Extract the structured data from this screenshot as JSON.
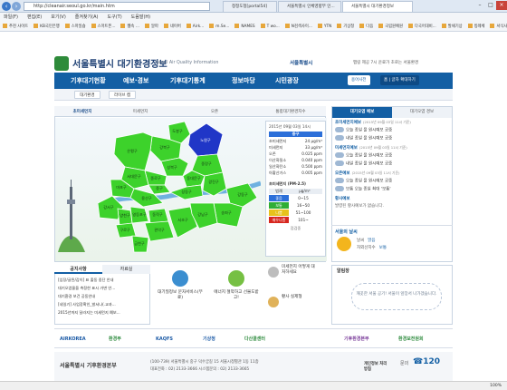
{
  "browser": {
    "url": "http://cleanair.seoul.go.kr/main.htm",
    "tabs": [
      "청정도청[portal54]",
      "서울특별시 인체영향부 인...",
      "서울특별시 대기환경정보"
    ],
    "menu": [
      "파일(F)",
      "편집(E)",
      "보기(V)",
      "즐겨찾기(A)",
      "도구(T)",
      "도움말(H)"
    ],
    "favorites": [
      "추천 사이트",
      "KB국민은행",
      "스마일숍",
      "스마트폰...",
      "웹속 …",
      "알파",
      "네이버",
      "Airk...",
      "m.Se...",
      "NAMES",
      "T wo...",
      "N검색사이...",
      "YTN",
      "기상청",
      "다음",
      "국립원예원",
      "다국어대비...",
      "발채기상",
      "빙례체",
      "서식사사",
      "유리온행",
      "free?"
    ],
    "zoom": "100%"
  },
  "header": {
    "site_title": "서울특별시 대기환경정보",
    "site_subtitle": "Seoul Air Quality Information",
    "seoul_logo": "서울특별시",
    "notice": "맵링 제공 7시 운료가 초로는 서울환경"
  },
  "gnb": {
    "items": [
      "기후대기현황",
      "예보·경보",
      "기후대기통계",
      "정보마당",
      "시민광장"
    ],
    "buttons": [
      "용어사전",
      "홈 | 글자 확대하기"
    ]
  },
  "subtabs": [
    "대기환경",
    "라이브 캠"
  ],
  "map_panel": {
    "tabs": [
      "초미세먼지",
      "미세먼지",
      "오존",
      "통합대기환경지수"
    ],
    "timestamp": "2015년 09월 03일 14시",
    "district_label": "중구",
    "readings": [
      {
        "label": "초미세먼지",
        "value": "24 μg/m³"
      },
      {
        "label": "미세먼지",
        "value": "33 μg/m³"
      },
      {
        "label": "오존",
        "value": "0.025 ppm"
      },
      {
        "label": "이산화질소",
        "value": "0.040 ppm"
      },
      {
        "label": "일산화탄소",
        "value": "0.500 ppm"
      },
      {
        "label": "아황산가스",
        "value": "0.005 ppm"
      }
    ],
    "legend_title": "초미세먼지 (PM-2.5)",
    "legend_header": [
      "범례",
      "μg/m³"
    ],
    "legend": [
      {
        "label": "좋음",
        "range": "0~15",
        "color": "#2c6fd9"
      },
      {
        "label": "보통",
        "range": "16~50",
        "color": "#2fae35"
      },
      {
        "label": "나쁨",
        "range": "51~100",
        "color": "#e7c21b"
      },
      {
        "label": "매우나쁨",
        "range": "101~",
        "color": "#d7261e"
      }
    ],
    "check_label": "점검중",
    "districts": [
      "도봉구",
      "노원구",
      "강북구",
      "은평구",
      "성북구",
      "중랑구",
      "종로구",
      "동대문구",
      "서대문구",
      "마포구",
      "광진구",
      "중구",
      "성동구",
      "용산구",
      "강서구",
      "양천구",
      "강동구",
      "송파구",
      "영등포구",
      "동작구",
      "구로구",
      "관악구",
      "서초구",
      "강남구",
      "금천구"
    ],
    "highlight_district": "노원구"
  },
  "right_panel": {
    "tabs": [
      "대기오염 예보",
      "대기오염 경보"
    ],
    "forecast": [
      {
        "name": "초미세먼지예보",
        "date": "(2015년 09월 03일 11시 기준)",
        "line1": "오늘 종일 물 원시예보 공중",
        "line2": "내일 종일 물 원시예보 공중"
      },
      {
        "name": "미세먼지예보",
        "date": "(2015년 09월 03일 11시 기준)",
        "line1": "오늘 종일 물 원시예보 공중",
        "line2": "내일 종일 물 원시예보 공중"
      },
      {
        "name": "오존예보",
        "date": "(2015년 09월 03일 11시 기준)",
        "line1": "오늘 종일 물 원시예보 공중",
        "line2": "보통 오늘 종일 최대 '보통'"
      }
    ],
    "hwangsa_title": "황사예보",
    "hwangsa_text": "발령된 황사예보가 없습니다.",
    "weather_title": "서울의 날씨",
    "weather": [
      {
        "label": "날씨",
        "value": "맑음"
      },
      {
        "label": "자외선지수",
        "value": "보통"
      }
    ]
  },
  "lower": {
    "notice_tabs": [
      "공지사항",
      "자료실"
    ],
    "notices": [
      "[입장/글된/갑이] 표 출동 중단 안내",
      "대기오염물을 측정한 표시 가변 안...",
      "대기환경 보건 공동안내",
      "[네일기] 사업장확인_발서나(.교과...",
      "2015년까지 달라지는 미세먼지 예보..."
    ],
    "services": [
      {
        "label": "대기질정보 문자서비스(무료)",
        "icon": "sms-phone-icon"
      },
      {
        "label": "에너지 절약하고 선물도받고!",
        "icon": "eco-mileage-icon"
      },
      {
        "label": "미세먼지 어떻게 대처하세요",
        "icon": "mask-person-icon"
      },
      {
        "label": "황사 실제형",
        "icon": "dust-cloud-icon"
      }
    ],
    "today_title": "알림창",
    "today_text": "깨끗한 서울 공기! 서울이 앞장서 나가겠습니다."
  },
  "partners": [
    "AIRKOREA",
    "환경부",
    "KAQFS",
    "기상청",
    "다산콜센터",
    "기후환경본부",
    "환경보전원회"
  ],
  "footer": {
    "org": "서울특별시 기후환경본부",
    "address": "(100-739) 서울특별시 중구 덕수궁길 15 서울시청별관 1동 11층",
    "phone": "대표전화 : 02) 2133-3666  시스템문의 : 02) 2133-3665",
    "policy": "개인정보 처리방침",
    "call_label": "문의",
    "call": "☎120"
  }
}
